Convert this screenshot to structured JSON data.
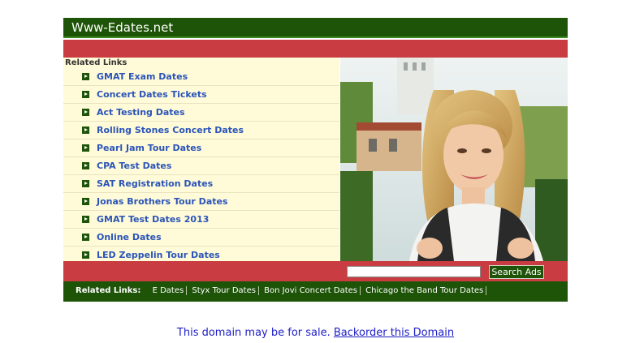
{
  "header": {
    "title": "Www-Edates.net"
  },
  "related": {
    "title": "Related Links",
    "items": [
      "GMAT Exam Dates",
      "Concert Dates Tickets",
      "Act Testing Dates",
      "Rolling Stones Concert Dates",
      "Pearl Jam Tour Dates",
      "CPA Test Dates",
      "SAT Registration Dates",
      "Jonas Brothers Tour Dates",
      "GMAT Test Dates 2013",
      "Online Dates",
      "LED Zeppelin Tour Dates"
    ]
  },
  "search": {
    "value": "",
    "button_label": "Search Ads"
  },
  "footer": {
    "title": "Related Links:",
    "items": [
      "E Dates",
      "Styx Tour Dates",
      "Bon Jovi Concert Dates",
      "Chicago the Band Tour Dates"
    ]
  },
  "sale": {
    "text": "This domain may be for sale.",
    "link": "Backorder this Domain"
  },
  "colors": {
    "green": "#1e5408",
    "red": "#c83c42",
    "cream": "#fffbd9",
    "link": "#2a54b8"
  }
}
